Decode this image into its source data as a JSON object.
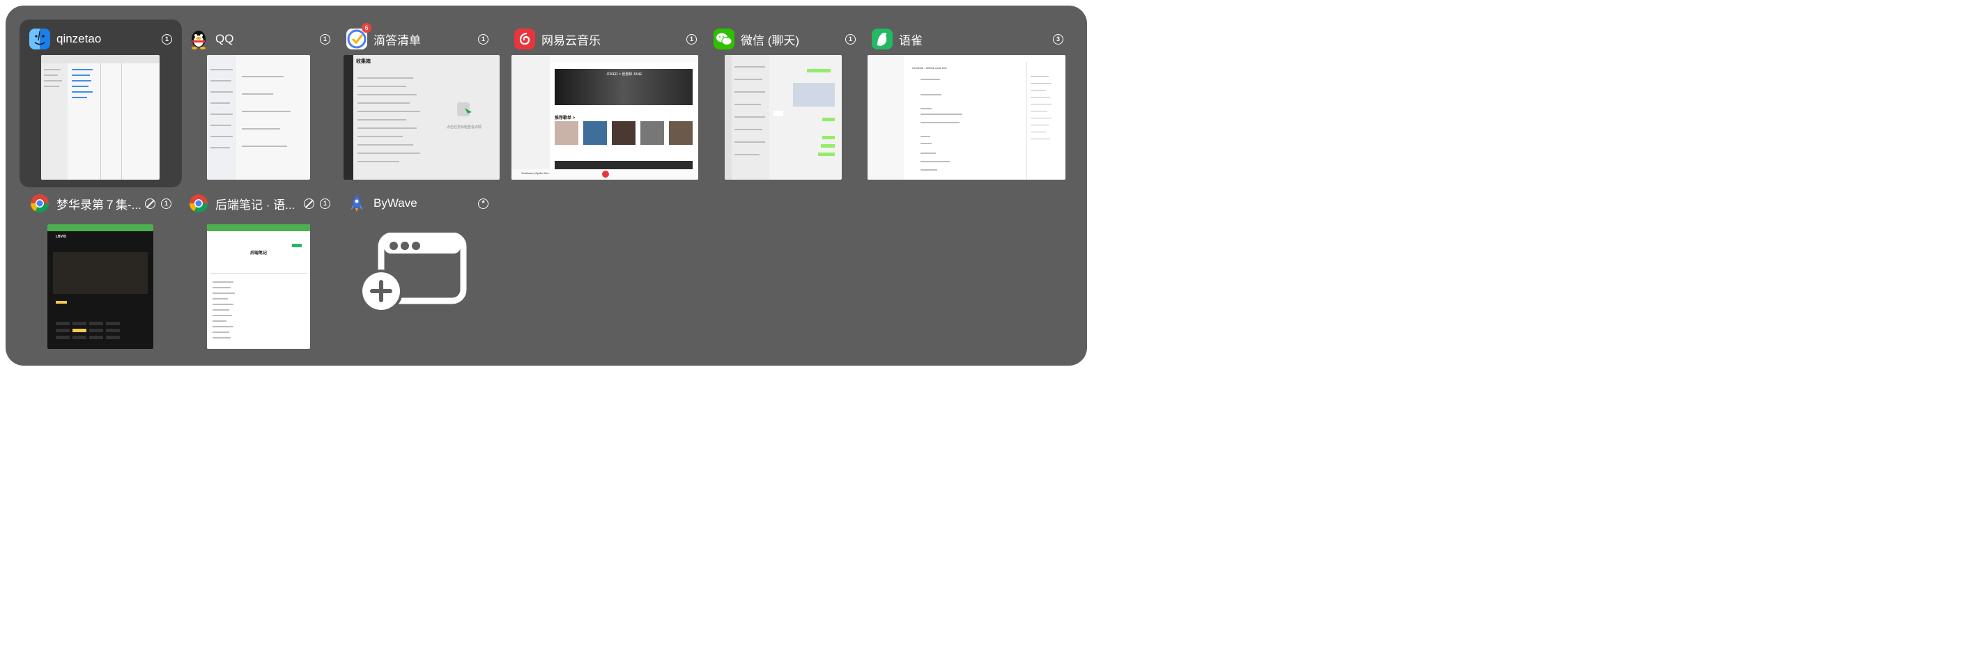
{
  "windows": [
    {
      "app": "qinzetao",
      "count": "1",
      "icon": "finder-icon",
      "color": "#1e88f0"
    },
    {
      "app": "QQ",
      "count": "1",
      "icon": "qq-penguin-icon",
      "color": "#ffffff"
    },
    {
      "app": "滴答清单",
      "count": "1",
      "badge": "6",
      "icon": "ticktick-icon",
      "color": "#4c7cf3"
    },
    {
      "app": "网易云音乐",
      "count": "1",
      "icon": "netease-music-icon",
      "color": "#e8353b"
    },
    {
      "app": "微信 (聊天)",
      "count": "1",
      "icon": "wechat-icon",
      "color": "#2dc100"
    },
    {
      "app": "语雀",
      "count": "3",
      "icon": "yuque-icon",
      "color": "#25b864"
    },
    {
      "app": "梦华录第７集-...",
      "count": "1",
      "icon": "chrome-icon",
      "hidden_indicator": "no-entry-icon"
    },
    {
      "app": "后端笔记 · 语...",
      "count": "1",
      "icon": "chrome-icon",
      "hidden_indicator": "no-entry-icon"
    },
    {
      "app": "ByWave",
      "count": "",
      "icon": "rocket-icon",
      "color": "#3a6fd8",
      "extra_icon": "asterisk-icon"
    }
  ],
  "thumbs": {
    "ticktick": {
      "title": "收集箱",
      "empty_hint": "点击任务标题查看详情"
    },
    "netease": {
      "banner": "JOKER × 张惠妹 JANE",
      "section": "推荐歌单 >",
      "player": "Sunflower (Spider-Ma..."
    },
    "yuque": {
      "heading": "OneNote - GitHub code tree"
    },
    "drama": {
      "logo": "LBVIO"
    },
    "notes": {
      "title": "后端笔记"
    }
  },
  "new_window_icon": "new-window-icon"
}
